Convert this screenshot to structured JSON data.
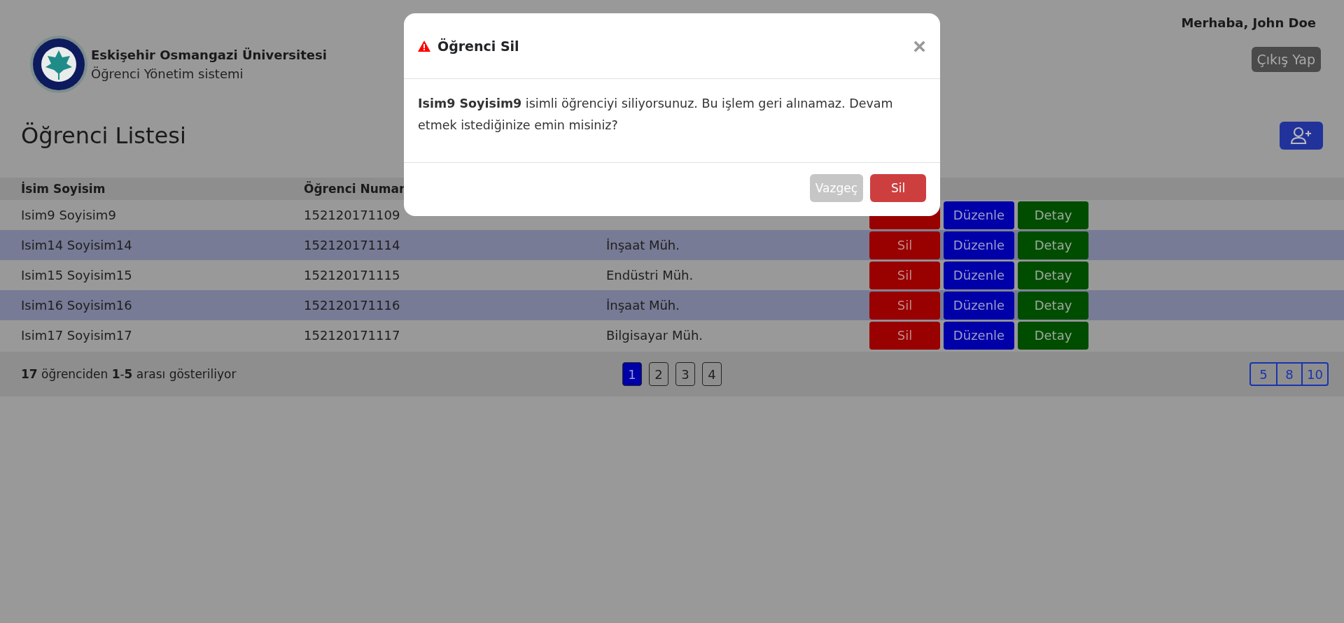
{
  "header": {
    "university": "Eskişehir Osmangazi Üniversitesi",
    "system": "Öğrenci Yönetim sistemi",
    "greeting": "Merhaba, John Doe",
    "logout": "Çıkış Yap"
  },
  "page_title": "Öğrenci Listesi",
  "table": {
    "columns": [
      "İsim Soyisim",
      "Öğrenci Numar"
    ],
    "rows": [
      {
        "name": "Isim9 Soyisim9",
        "number": "152120171109",
        "striped": false,
        "actions": [
          {
            "kind": "delete"
          },
          {
            "kind": "edit",
            "label": "Düzenle"
          },
          {
            "kind": "detail",
            "label": "Detay"
          }
        ]
      },
      {
        "name": "Isim14 Soyisim14",
        "number": "152120171114",
        "department": "İnşaat Müh.",
        "striped": true,
        "actions": [
          {
            "kind": "delete",
            "label": "Sil"
          },
          {
            "kind": "edit",
            "label": "Düzenle"
          },
          {
            "kind": "detail",
            "label": "Detay"
          }
        ]
      },
      {
        "name": "Isim15 Soyisim15",
        "number": "152120171115",
        "department": "Endüstri Müh.",
        "striped": false,
        "actions": [
          {
            "kind": "delete",
            "label": "Sil"
          },
          {
            "kind": "edit",
            "label": "Düzenle"
          },
          {
            "kind": "detail",
            "label": "Detay"
          }
        ]
      },
      {
        "name": "Isim16 Soyisim16",
        "number": "152120171116",
        "department": "İnşaat Müh.",
        "striped": true,
        "actions": [
          {
            "kind": "delete",
            "label": "Sil"
          },
          {
            "kind": "edit",
            "label": "Düzenle"
          },
          {
            "kind": "detail",
            "label": "Detay"
          }
        ]
      },
      {
        "name": "Isim17 Soyisim17",
        "number": "152120171117",
        "department": "Bilgisayar Müh.",
        "striped": false,
        "actions": [
          {
            "kind": "delete",
            "label": "Sil"
          },
          {
            "kind": "edit",
            "label": "Düzenle"
          },
          {
            "kind": "detail",
            "label": "Detay"
          }
        ]
      }
    ]
  },
  "footer": {
    "summary": "**17** öğrenciden **1**-**5** arası gösteriliyor",
    "pages": [
      {
        "label": "1",
        "selected": true
      },
      {
        "label": "2",
        "selected": false
      },
      {
        "label": "3",
        "selected": false
      },
      {
        "label": "4",
        "selected": false
      }
    ],
    "page_sizes": [
      "5",
      "8",
      "10"
    ]
  },
  "modal": {
    "title": "Öğrenci Sil",
    "close": "×",
    "message": "**Isim9 Soyisim9** isimli öğrenciyi siliyorsunuz. Bu işlem geri alınamaz. Devam etmek istediğinize emin misiniz?",
    "cancel": "Vazgeç",
    "confirm": "Sil"
  }
}
